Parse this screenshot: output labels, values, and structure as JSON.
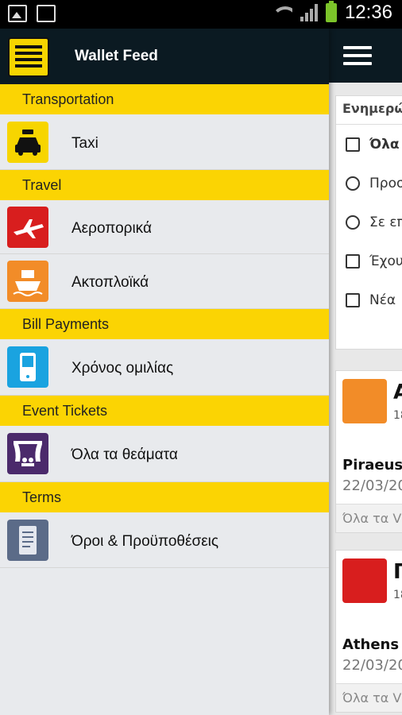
{
  "status_bar": {
    "time": "12:36"
  },
  "drawer": {
    "title": "Wallet Feed",
    "sections": [
      {
        "header": "Transportation",
        "items": [
          {
            "label": "Taxi",
            "icon": "taxi-icon"
          }
        ]
      },
      {
        "header": "Travel",
        "items": [
          {
            "label": "Αεροπορικά",
            "icon": "airplane-icon"
          },
          {
            "label": "Ακτοπλοϊκά",
            "icon": "ship-icon"
          }
        ]
      },
      {
        "header": "Bill Payments",
        "items": [
          {
            "label": "Χρόνος ομιλίας",
            "icon": "mobile-phone-icon"
          }
        ]
      },
      {
        "header": "Event Tickets",
        "items": [
          {
            "label": "Όλα τα θεάματα",
            "icon": "theater-icon"
          }
        ]
      },
      {
        "header": "Terms",
        "items": [
          {
            "label": "Όροι & Προϋποθέσεις",
            "icon": "document-icon"
          }
        ]
      }
    ]
  },
  "background": {
    "menu_header": "Ενημερώ",
    "menu_items": [
      {
        "label": "Όλα",
        "icon": "grid-icon"
      },
      {
        "label": "Προσ",
        "icon": "clock-icon"
      },
      {
        "label": "Σε επ",
        "icon": "gear-icon"
      },
      {
        "label": "Έχου",
        "icon": "checkbox-icon"
      },
      {
        "label": "Νέα",
        "icon": "list-icon"
      }
    ],
    "cards": [
      {
        "letter": "Α",
        "number": "18",
        "city": "Piraeus",
        "date": "22/03/20",
        "footer": "Όλα τα V",
        "icon": "ship-icon"
      },
      {
        "letter": "Π",
        "number": "18",
        "city": "Athens",
        "date": "22/03/20",
        "footer": "Όλα τα V",
        "icon": "airplane-icon"
      }
    ]
  },
  "colors": {
    "accent_yellow": "#fbd403",
    "header_dark": "#0b1a22",
    "taxi": "#f7d500",
    "airplane": "#d81e1e",
    "ship": "#f28c28",
    "mobile": "#1aa3e0",
    "theater": "#4b2a6b",
    "document": "#5b6b88"
  }
}
